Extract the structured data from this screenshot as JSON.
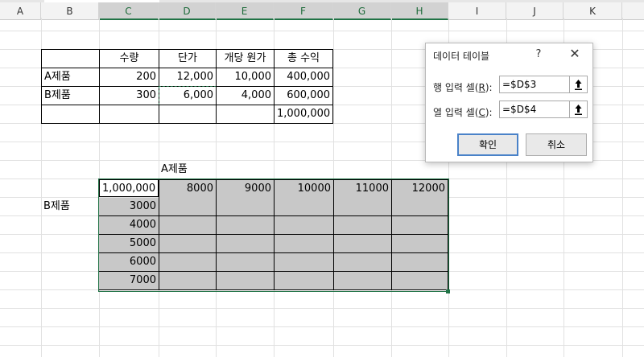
{
  "columns": [
    "A",
    "B",
    "C",
    "D",
    "E",
    "F",
    "G",
    "H",
    "I",
    "J",
    "K"
  ],
  "cells": {
    "c3": "수량",
    "d3": "단가",
    "e3": "개당 원가",
    "f3": "총 수익",
    "b4": "A제품",
    "c4": "200",
    "d4": "12,000",
    "e4": "10,000",
    "f4": "400,000",
    "b5": "B제품",
    "c5": "300",
    "d5": "6,000",
    "e5": "4,000",
    "f5": "600,000",
    "f6": "1,000,000",
    "d9": "A제품",
    "c10": "1,000,000",
    "d10": "8000",
    "e10": "9000",
    "f10": "10000",
    "g10": "11000",
    "h10": "12000",
    "b11": "B제품",
    "c11": "3000",
    "c12": "4000",
    "c13": "5000",
    "c14": "6000",
    "c15": "7000"
  },
  "dialog": {
    "title": "데이터 테이블",
    "help": "?",
    "close": "✕",
    "row_label_prefix": "행 입력 셀(",
    "row_label_key": "R",
    "row_label_suffix": "):",
    "row_value": "=$D$3",
    "col_label_prefix": "열 입력 셀(",
    "col_label_key": "C",
    "col_label_suffix": "):",
    "col_value": "=$D$4",
    "ok": "확인",
    "cancel": "취소",
    "pick_icon": "range-picker-icon"
  }
}
